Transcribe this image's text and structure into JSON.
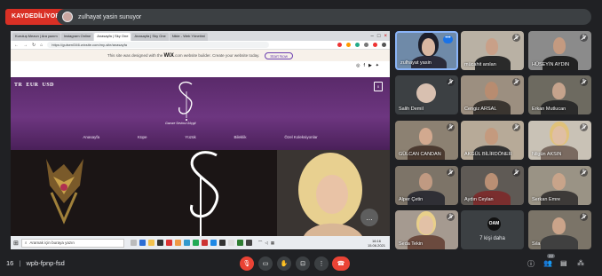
{
  "header": {
    "recording_label": "KAYDEDİLİYOR",
    "presenting_text": "zulhayat yasin sunuyor"
  },
  "browser": {
    "tabs": [
      {
        "label": "Kuruluş Mezun | Ara yazım",
        "active": false
      },
      {
        "label": "Instagram Online",
        "active": false
      },
      {
        "label": "Anasayfa | Sky One",
        "active": true
      },
      {
        "label": "Anasayfa | Sky One",
        "active": false
      },
      {
        "label": "Nikle - Web Yönetimi",
        "active": false
      }
    ],
    "url": "https://gulsenI346.wixsite.com/my-site/anasayfa",
    "wix_banner_text": "This site was designed with the",
    "wix_brand": "WIX",
    "wix_banner_text_after": ".com website builder. Create your website today.",
    "upgrade_button": "Start Now"
  },
  "website": {
    "currency_bar": "TR  EUR  USD",
    "logo_subtitle": "Gamze Sevinsi Göçgil",
    "nav_items": [
      "Anasayfa",
      "Küpe",
      "Yüzük",
      "Bileklik",
      "Özel Koleksiyonlar"
    ]
  },
  "taskbar": {
    "search_placeholder": "Aramak için buraya yazın",
    "time": "16:16",
    "date": "15.06.2021"
  },
  "participants": [
    {
      "name": "zulhayat yasin",
      "muted": false,
      "you": true
    },
    {
      "name": "mücahit arslan",
      "muted": true
    },
    {
      "name": "HÜSEYİN AYDIN",
      "muted": true
    },
    {
      "name": "Salih Demil",
      "muted": true
    },
    {
      "name": "Cengiz ARSAL",
      "muted": true
    },
    {
      "name": "Erkan Mutlucan",
      "muted": true
    },
    {
      "name": "GÜLCAN CANDAN",
      "muted": true
    },
    {
      "name": "AKGÜL BİLİRDÖNER",
      "muted": true
    },
    {
      "name": "Nilgün AKSIN",
      "muted": true
    },
    {
      "name": "Alper Çetin",
      "muted": true
    },
    {
      "name": "Aydın Ceylan",
      "muted": true
    },
    {
      "name": "Serkan Emre",
      "muted": true
    },
    {
      "name": "Seda Tekin",
      "muted": true
    },
    {
      "name": "7 kişi daha",
      "muted": false,
      "others_initials": "OAM"
    },
    {
      "name": "Sıla",
      "muted": true
    }
  ],
  "footer": {
    "meeting_code": "wpb-fpnp-fsd",
    "separator": "|",
    "people_count": "22",
    "time_prefix": "16"
  },
  "colors": {
    "meet_bg": "#202124",
    "recording": "#d93025",
    "hero_purple": "#6d3680",
    "danger": "#ea4335",
    "accent_blue": "#8ab4f8"
  }
}
